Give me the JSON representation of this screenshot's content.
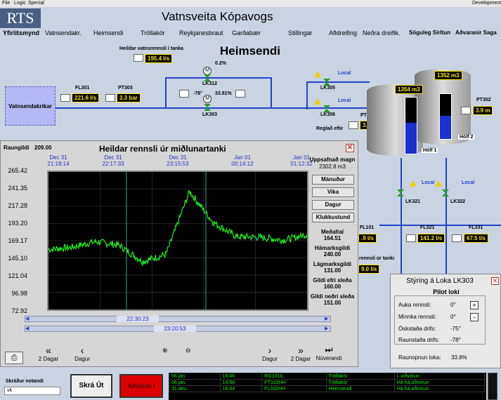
{
  "menu": [
    "File",
    "Logic",
    "Special"
  ],
  "menu_right": "Development",
  "logo": "RTS",
  "app_title": "Vatnsveita Kópavogs",
  "nav": [
    "Yfirlitsmynd",
    "Vatnsendakr.",
    "Heimsendi",
    "Tröllakór",
    "Reykjanesbraut",
    "Garðabær",
    "Stillingar",
    "Afldreifing",
    "Neðra dreifik.",
    "Söguleg Sirltun",
    "Aðvaranir Saga"
  ],
  "page_heading": "Heimsendi",
  "schematic": {
    "total_label": "Heildar vatnsrennsli í tanka",
    "total_value": "195.4 l/s",
    "source": "Vatnsendakrikar",
    "fl301_name": "FL301",
    "fl301_value": "221.6 l/s",
    "pt303_name": "PT303",
    "pt303_value": "3.3 bar",
    "lk312": "LK312",
    "lk312_pct": "0.2%",
    "lk303": "LK303",
    "lk303_pct": "33.81%",
    "lk303_deg": "-78°",
    "lk305": "LK305",
    "lk306": "LK306",
    "local": "Local",
    "pt301_name": "PT301",
    "pt301_value": "3.9 m",
    "regl_label": "Reglað eftir",
    "tank1_vol": "1354 m3",
    "tank2_vol": "1352 m3",
    "tank1_name": "Hólf 1",
    "tank2_name": "Hólf 2",
    "pt302_name": "PT302",
    "pt302_value": "3.9 m",
    "lk321": "LK321",
    "lk322": "LK322",
    "fl101_name": "FL101",
    "fl101_value": ".9 l/s",
    "fl321_name": "FL321",
    "fl321_value": "141.2 l/s",
    "fl331_name": "FL331",
    "fl331_value": "67.5 l/s",
    "out_label": "rennsli úr tanki",
    "out_value": "9.0 l/s"
  },
  "trend": {
    "raungildi_label": "Raungildi",
    "raungildi_value": "209.00",
    "title": "Heildar rennsli úr miðlunartanki",
    "x_ticks": [
      {
        "d": "Dec 31",
        "t": "21:18:14"
      },
      {
        "d": "Dec 31",
        "t": "22:17:33"
      },
      {
        "d": "Dec 31",
        "t": "23:15:53"
      },
      {
        "d": "Jan 01",
        "t": "00:14:12"
      },
      {
        "d": "Jan 01",
        "t": "01:12:32"
      }
    ],
    "y_ticks": [
      "265.42",
      "241.35",
      "217.28",
      "193.20",
      "169.17",
      "145.10",
      "121.04",
      "96.98",
      "72.92"
    ],
    "acc_label": "Uppsafnað magn",
    "acc_value": "2302.8 m3",
    "buttons": [
      "Mánuður",
      "Vika",
      "Dagur",
      "Klukkustund"
    ],
    "stats": [
      {
        "label": "Meðaltal",
        "value": "164.51"
      },
      {
        "label": "Hámarksgildi",
        "value": "240.00"
      },
      {
        "label": "Lágmarksgildi",
        "value": "131.00"
      },
      {
        "label": "Gildi efri sleða",
        "value": "160.00"
      },
      {
        "label": "Gildi neðri sleða",
        "value": "151.00"
      }
    ],
    "cursor_top": "22:30:23",
    "cursor_bottom": "23:20:53",
    "nav_buttons": [
      "2 Dagar",
      "Dagur",
      "Dagur",
      "2 Dagar",
      "Núverandi"
    ]
  },
  "chart_data": {
    "type": "line",
    "title": "Heildar rennsli úr miðlunartanki",
    "x": [
      "21:18",
      "21:45",
      "22:10",
      "22:30",
      "22:50",
      "23:10",
      "23:15",
      "23:40",
      "00:05",
      "00:30",
      "00:50",
      "01:12"
    ],
    "values": [
      157,
      160,
      168,
      163,
      140,
      150,
      238,
      195,
      175,
      174,
      170,
      178
    ],
    "ylim": [
      72.92,
      265.42
    ]
  },
  "lk_panel": {
    "title": "Stýring á Loka LK303",
    "subtitle": "Pilot loki",
    "rows": [
      {
        "label": "Auka rennsli:",
        "value": "0°",
        "btn": "+"
      },
      {
        "label": "Minnka rennsli:",
        "value": "0°",
        "btn": "-"
      },
      {
        "label": "Óskstaða drifs:",
        "value": "-75°"
      },
      {
        "label": "Raunstaða drifs:",
        "value": "-78°"
      }
    ],
    "opening_label": "Raunopnun loka:",
    "opening_value": "33.8%"
  },
  "bottom": {
    "user_label": "Skráður notandi",
    "user_value": "vk",
    "logout": "Skrá Út",
    "alarm_btn": "Aðvörun I",
    "alarms": [
      [
        "06 jan.",
        "16:46",
        "RG101IL",
        "Tröllakór",
        "L viðvörun"
      ],
      [
        "06 jan.",
        "14:58",
        "PT102HH",
        "Tröllakór",
        "Há há aðvörun"
      ],
      [
        "31 des.",
        "16:44",
        "FL332HH",
        "Heimsendi",
        "Há há aðvörun"
      ]
    ]
  },
  "colors": {
    "accent": "#2244cc",
    "trend": "#22ee22",
    "tag": "#ffe800",
    "alarm": "#dd0000"
  }
}
